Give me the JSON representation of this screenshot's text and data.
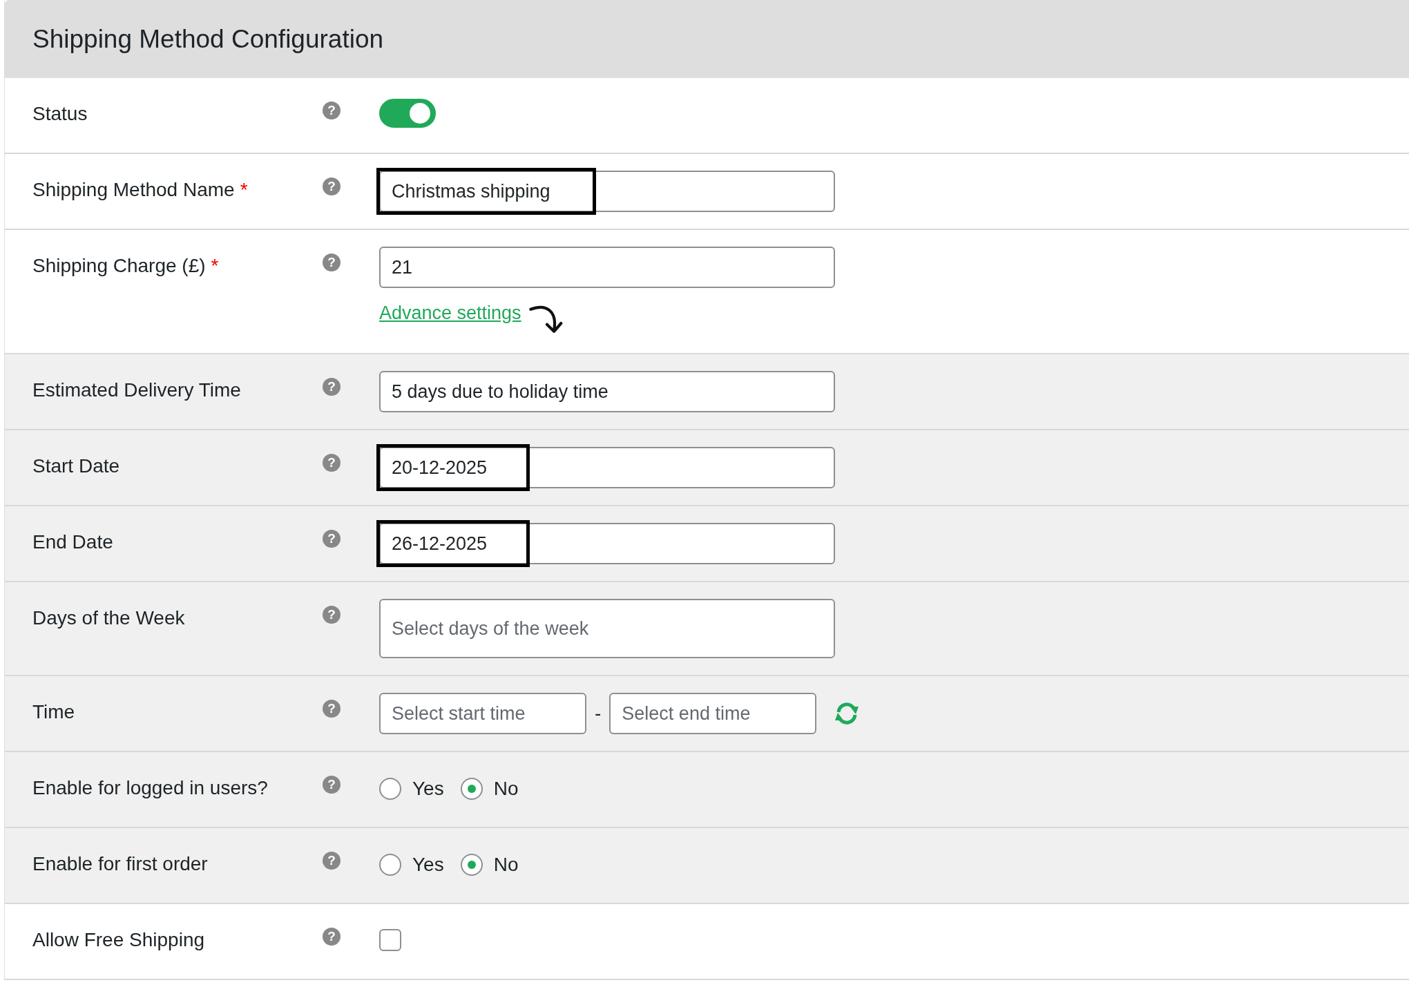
{
  "panel": {
    "title": "Shipping Method Configuration"
  },
  "rows": [
    {
      "kind": "toggle",
      "label": "Status",
      "help": "?",
      "shaded": false,
      "on": true
    },
    {
      "kind": "text",
      "label": "Shipping Method Name",
      "required_mark": "*",
      "help": "?",
      "shaded": false,
      "value": "Christmas shipping",
      "highlighted": true
    },
    {
      "kind": "text",
      "label": "Shipping Charge (£)",
      "required_mark": "*",
      "help": "?",
      "shaded": false,
      "value": "21",
      "highlighted": false,
      "link": "Advance settings"
    },
    {
      "kind": "text",
      "label": "Estimated Delivery Time",
      "help": "?",
      "shaded": true,
      "value": "5 days due to holiday time",
      "highlighted": false
    },
    {
      "kind": "text",
      "label": "Start Date",
      "help": "?",
      "shaded": true,
      "value": "20-12-2025",
      "highlighted": true
    },
    {
      "kind": "text",
      "label": "End Date",
      "help": "?",
      "shaded": true,
      "value": "26-12-2025",
      "highlighted": true
    },
    {
      "kind": "multiselect",
      "label": "Days of the Week",
      "help": "?",
      "shaded": true,
      "placeholder": "Select days of the week"
    },
    {
      "kind": "timerange",
      "label": "Time",
      "help": "?",
      "shaded": true,
      "start_placeholder": "Select start time",
      "separator": "-",
      "end_placeholder": "Select end time"
    },
    {
      "kind": "radio",
      "label": "Enable for logged in users?",
      "help": "?",
      "shaded": true,
      "options": [
        {
          "label": "Yes",
          "selected": false
        },
        {
          "label": "No",
          "selected": true
        }
      ]
    },
    {
      "kind": "radio",
      "label": "Enable for first order",
      "help": "?",
      "shaded": true,
      "options": [
        {
          "label": "Yes",
          "selected": false
        },
        {
          "label": "No",
          "selected": true
        }
      ]
    },
    {
      "kind": "checkbox",
      "label": "Allow Free Shipping",
      "help": "?",
      "shaded": false,
      "checked": false
    }
  ]
}
